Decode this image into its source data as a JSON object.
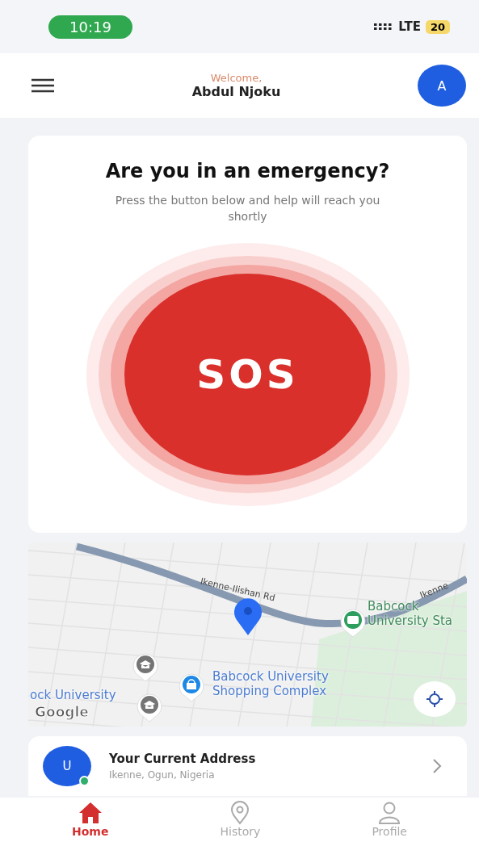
{
  "status_bar": {
    "time": "10:19",
    "network": "LTE",
    "battery": "20"
  },
  "header": {
    "greeting": "Welcome,",
    "name": "Abdul Njoku",
    "avatar": "A"
  },
  "emergency": {
    "title": "Are you in an emergency?",
    "subtitle": "Press the button below and help will reach you shortly",
    "button": "SOS"
  },
  "map": {
    "roads": [
      {
        "label": "Ikenne-Ilishan Rd"
      },
      {
        "label": "Ikenne"
      }
    ],
    "places": [
      {
        "kind": "bus",
        "label": "Babcock\nUniversity Sta"
      },
      {
        "kind": "school"
      },
      {
        "kind": "school",
        "label": "ock University"
      },
      {
        "kind": "shop",
        "label": "Babcock University\nShopping Complex"
      }
    ],
    "logo": "Google"
  },
  "address": {
    "avatar": "U",
    "online": true,
    "title": "Your Current Address",
    "subtitle": "Ikenne, Ogun, Nigeria"
  },
  "nav": [
    {
      "kind": "home",
      "label": "Home",
      "selected": true
    },
    {
      "kind": "history",
      "label": "History",
      "selected": false
    },
    {
      "kind": "profile",
      "label": "Profile",
      "selected": false
    }
  ]
}
